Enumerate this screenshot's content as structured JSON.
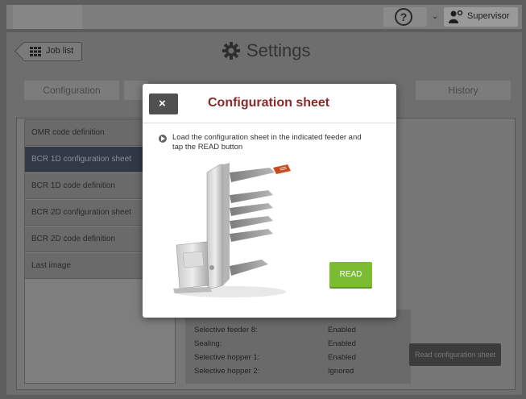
{
  "header": {
    "user_label": "Supervisor"
  },
  "nav": {
    "job_list_label": "Job list",
    "page_title": "Settings"
  },
  "tabs": [
    {
      "label": "Configuration"
    },
    {
      "label": ""
    },
    {
      "label": ""
    },
    {
      "label": ""
    },
    {
      "label": "History"
    }
  ],
  "sidebar": {
    "items": [
      {
        "label": "OMR code definition"
      },
      {
        "label": "BCR 1D configuration sheet"
      },
      {
        "label": "BCR 1D code definition"
      },
      {
        "label": "BCR 2D configuration sheet"
      },
      {
        "label": "BCR 2D code definition"
      },
      {
        "label": "Last image"
      }
    ]
  },
  "settings_list": [
    {
      "label": "Selective feeder 8:",
      "value": "Enabled"
    },
    {
      "label": "Sealing:",
      "value": "Enabled"
    },
    {
      "label": "Selective hopper 1:",
      "value": "Enabled"
    },
    {
      "label": "Selective hopper 2:",
      "value": "Ignored"
    }
  ],
  "read_configuration_sheet_label": "Read configuration sheet",
  "modal": {
    "title": "Configuration sheet",
    "instruction": "Load the configuration sheet in the indicated feeder and tap the READ button",
    "read_label": "READ",
    "close_glyph": "×"
  },
  "colors": {
    "accent_title": "#8c2a2a",
    "read_button": "#7bbc31",
    "selected_item": "#323846"
  }
}
